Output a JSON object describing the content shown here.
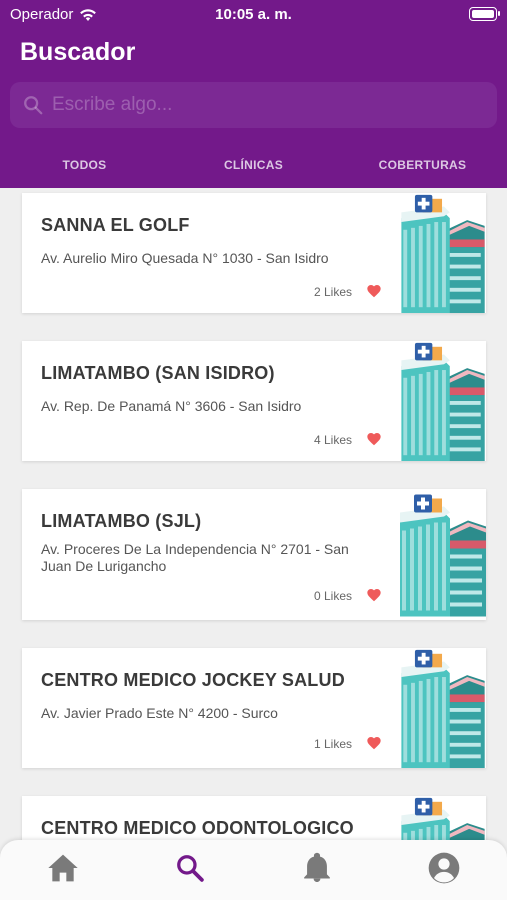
{
  "status_bar": {
    "carrier": "Operador",
    "time": "10:05 a. m."
  },
  "header": {
    "title": "Buscador"
  },
  "search": {
    "placeholder": "Escribe algo..."
  },
  "tabs": [
    {
      "label": "TODOS"
    },
    {
      "label": "CLÍNICAS"
    },
    {
      "label": "COBERTURAS"
    }
  ],
  "clinics": [
    {
      "name": "SANNA EL GOLF",
      "address": "Av. Aurelio Miro Quesada N° 1030 - San Isidro",
      "likes": "2 Likes"
    },
    {
      "name": "LIMATAMBO (SAN ISIDRO)",
      "address": "Av. Rep. De Panamá N° 3606 - San Isidro",
      "likes": "4 Likes"
    },
    {
      "name": "LIMATAMBO (SJL)",
      "address": "Av. Proceres De La Independencia N° 2701 - San Juan De Lurigancho",
      "likes": "0 Likes"
    },
    {
      "name": "CENTRO MEDICO JOCKEY SALUD",
      "address": "Av. Javier Prado Este N° 4200 - Surco",
      "likes": "1 Likes"
    },
    {
      "name": "CENTRO MEDICO ODONTOLOGICO",
      "address": "",
      "likes": ""
    }
  ],
  "bottom_nav": [
    {
      "icon": "home-icon"
    },
    {
      "icon": "search-icon",
      "active": true
    },
    {
      "icon": "bell-icon"
    },
    {
      "icon": "profile-icon"
    }
  ],
  "colors": {
    "primary": "#73198a",
    "tab_text": "#dcc7e3",
    "heart": "#ef5a5a",
    "inactive_icon": "#7a7a7a"
  }
}
